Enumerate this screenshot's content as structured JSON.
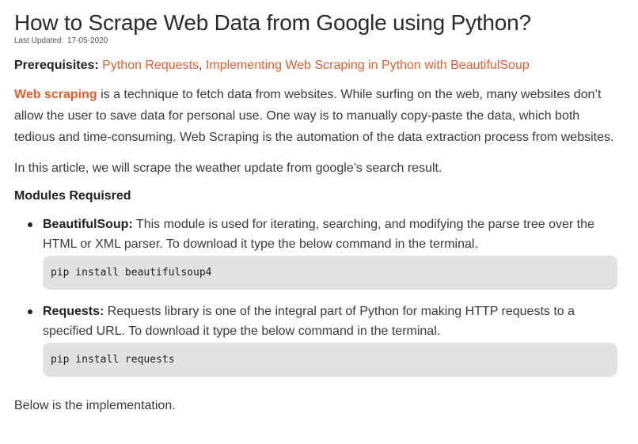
{
  "article": {
    "title": "How to Scrape Web Data from Google using Python?",
    "last_updated_label": "Last Updated:",
    "last_updated_date": "17-05-2020",
    "prerequisites": {
      "label": "Prerequisites:",
      "link1": "Python Requests",
      "separator": ", ",
      "link2": "Implementing Web Scraping in Python with BeautifulSoup"
    },
    "paragraph1": {
      "link": "Web scraping",
      "text": " is a technique to fetch data from websites. While surfing on the web, many websites don’t allow the user to save data for personal use. One way is to manually copy-paste the data, which both tedious and time-consuming. Web Scraping is the automation of the data extraction process from websites."
    },
    "paragraph2": "In this article, we will scrape the weather update from google’s search result.",
    "modules_heading": "Modules Requisred",
    "modules": [
      {
        "name": "BeautifulSoup:",
        "description": " This module is used for iterating, searching, and modifying the parse tree over the HTML or XML parser. To download it type the below command in the terminal.",
        "command": "pip install beautifulsoup4"
      },
      {
        "name": "Requests:",
        "description": " Requests library is one of the integral part of Python for making HTTP requests to a specified URL. To download it type the below command in the terminal.",
        "command": "pip install requests"
      }
    ],
    "closing": "Below is the implementation."
  },
  "colors": {
    "link": "#e35d2c",
    "code_background": "#e2e2e2",
    "text": "#3a3a3a"
  }
}
